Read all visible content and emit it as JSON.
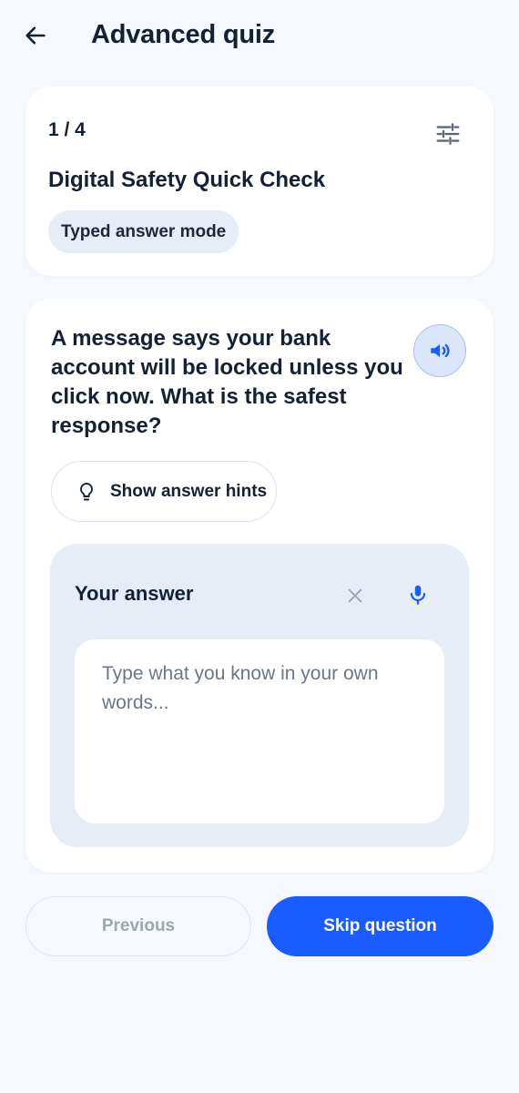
{
  "header": {
    "back_icon": "arrow-left-icon",
    "title": "Advanced quiz"
  },
  "quiz_info": {
    "progress": "1 / 4",
    "current_question": 1,
    "total_questions": 4,
    "settings_icon": "sliders-icon",
    "title": "Digital Safety Quick Check",
    "mode": "Typed answer mode"
  },
  "question": {
    "text": "A message says your bank account will be locked unless you click now. What is the safest response?",
    "audio_icon": "speaker-icon",
    "hint_icon": "lightbulb-icon",
    "hint_label": "Show answer hints"
  },
  "answer": {
    "label": "Your answer",
    "clear_icon": "close-icon",
    "mic_icon": "microphone-icon",
    "value": "",
    "placeholder": "Type what you know in your own words..."
  },
  "navigation": {
    "previous_label": "Previous",
    "skip_label": "Skip question"
  },
  "colors": {
    "background": "#f5f8fc",
    "card": "#ffffff",
    "text": "#142033",
    "accent": "#1a5cff",
    "panel": "#e6edf6",
    "badge": "#e7edf6",
    "disabled_text": "#9aa5b5"
  }
}
